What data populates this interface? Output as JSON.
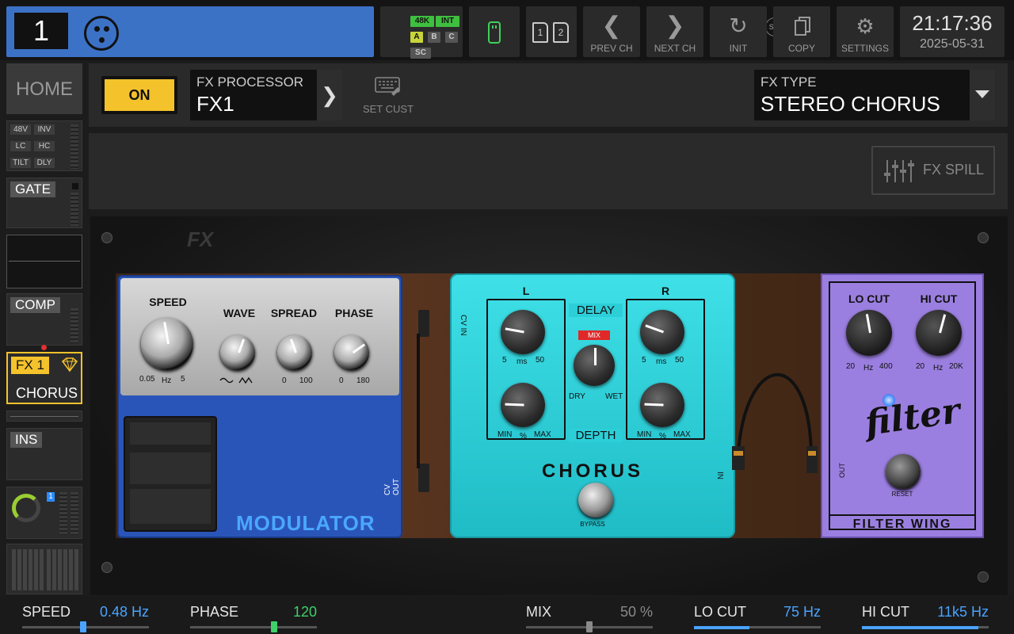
{
  "top": {
    "channel_number": "1",
    "sip_label": "SIP",
    "tags": {
      "k48": "48K",
      "int": "INT",
      "a": "A",
      "b": "B",
      "c": "C",
      "sc": "SC"
    },
    "card1": "1",
    "card2": "2",
    "prev_label": "PREV CH",
    "next_label": "NEXT CH",
    "init_label": "INIT",
    "copy_label": "COPY",
    "settings_label": "SETTINGS",
    "time": "21:17:36",
    "date": "2025-05-31"
  },
  "sidebar": {
    "home": "HOME",
    "input_tags": [
      "48V",
      "INV",
      "LC",
      "HC",
      "TILT",
      "DLY"
    ],
    "gate": "GATE",
    "comp": "COMP",
    "fx_slot": "FX 1",
    "fx_name": "CHORUS",
    "ins": "INS",
    "meter_badge": "1"
  },
  "header": {
    "on_label": "ON",
    "fx_processor_label": "FX PROCESSOR",
    "fx_processor_value": "FX1",
    "set_cust_label": "SET CUST",
    "fx_type_label": "FX TYPE",
    "fx_type_value": "STEREO CHORUS",
    "fx_spill_label": "FX SPILL"
  },
  "pedals": {
    "modulator": {
      "name": "MODULATOR",
      "speed": "SPEED",
      "speed_min": "0.05",
      "speed_unit": "Hz",
      "speed_max": "5",
      "wave": "WAVE",
      "spread": "SPREAD",
      "spread_min": "0",
      "spread_max": "100",
      "phase": "PHASE",
      "phase_min": "0",
      "phase_max": "180",
      "cv_out": "CV OUT"
    },
    "chorus": {
      "name": "CHORUS",
      "cv_in": "CV IN",
      "in_label": "IN",
      "l": "L",
      "r": "R",
      "delay": "DELAY",
      "depth": "DEPTH",
      "mix": "MIX",
      "delay_min": "5",
      "delay_unit": "ms",
      "delay_max": "50",
      "depth_min": "MIN",
      "depth_unit": "%",
      "depth_max": "MAX",
      "dry": "DRY",
      "wet": "WET",
      "bypass": "BYPASS"
    },
    "filter": {
      "name": "FILTER WING",
      "logo": "filter",
      "lo_cut": "LO CUT",
      "lo_min": "20",
      "lo_unit": "Hz",
      "lo_max": "400",
      "hi_cut": "HI CUT",
      "hi_min": "20",
      "hi_unit": "Hz",
      "hi_max": "20K",
      "out": "OUT",
      "reset": "RESET"
    }
  },
  "bottom": {
    "speed": {
      "name": "SPEED",
      "value": "0.48 Hz",
      "color": "#4aa3ff",
      "level": 0.48
    },
    "phase": {
      "name": "PHASE",
      "value": "120",
      "color": "#3fd06a",
      "level": 0.67
    },
    "mix": {
      "name": "MIX",
      "value": "50 %",
      "color": "#8a8a8a",
      "level": 0.5
    },
    "lo_cut": {
      "name": "LO CUT",
      "value": "75 Hz",
      "color": "#4aa3ff",
      "level": 0.44
    },
    "hi_cut": {
      "name": "HI CUT",
      "value": "11k5 Hz",
      "color": "#4aa3ff",
      "level": 0.92
    }
  },
  "colors": {
    "accent_blue": "#3c72c6",
    "on_yellow": "#f4c22b",
    "chorus_teal": "#2ccfd8",
    "filter_purple": "#9b7fe0",
    "modulator_blue": "#2a55b8"
  }
}
